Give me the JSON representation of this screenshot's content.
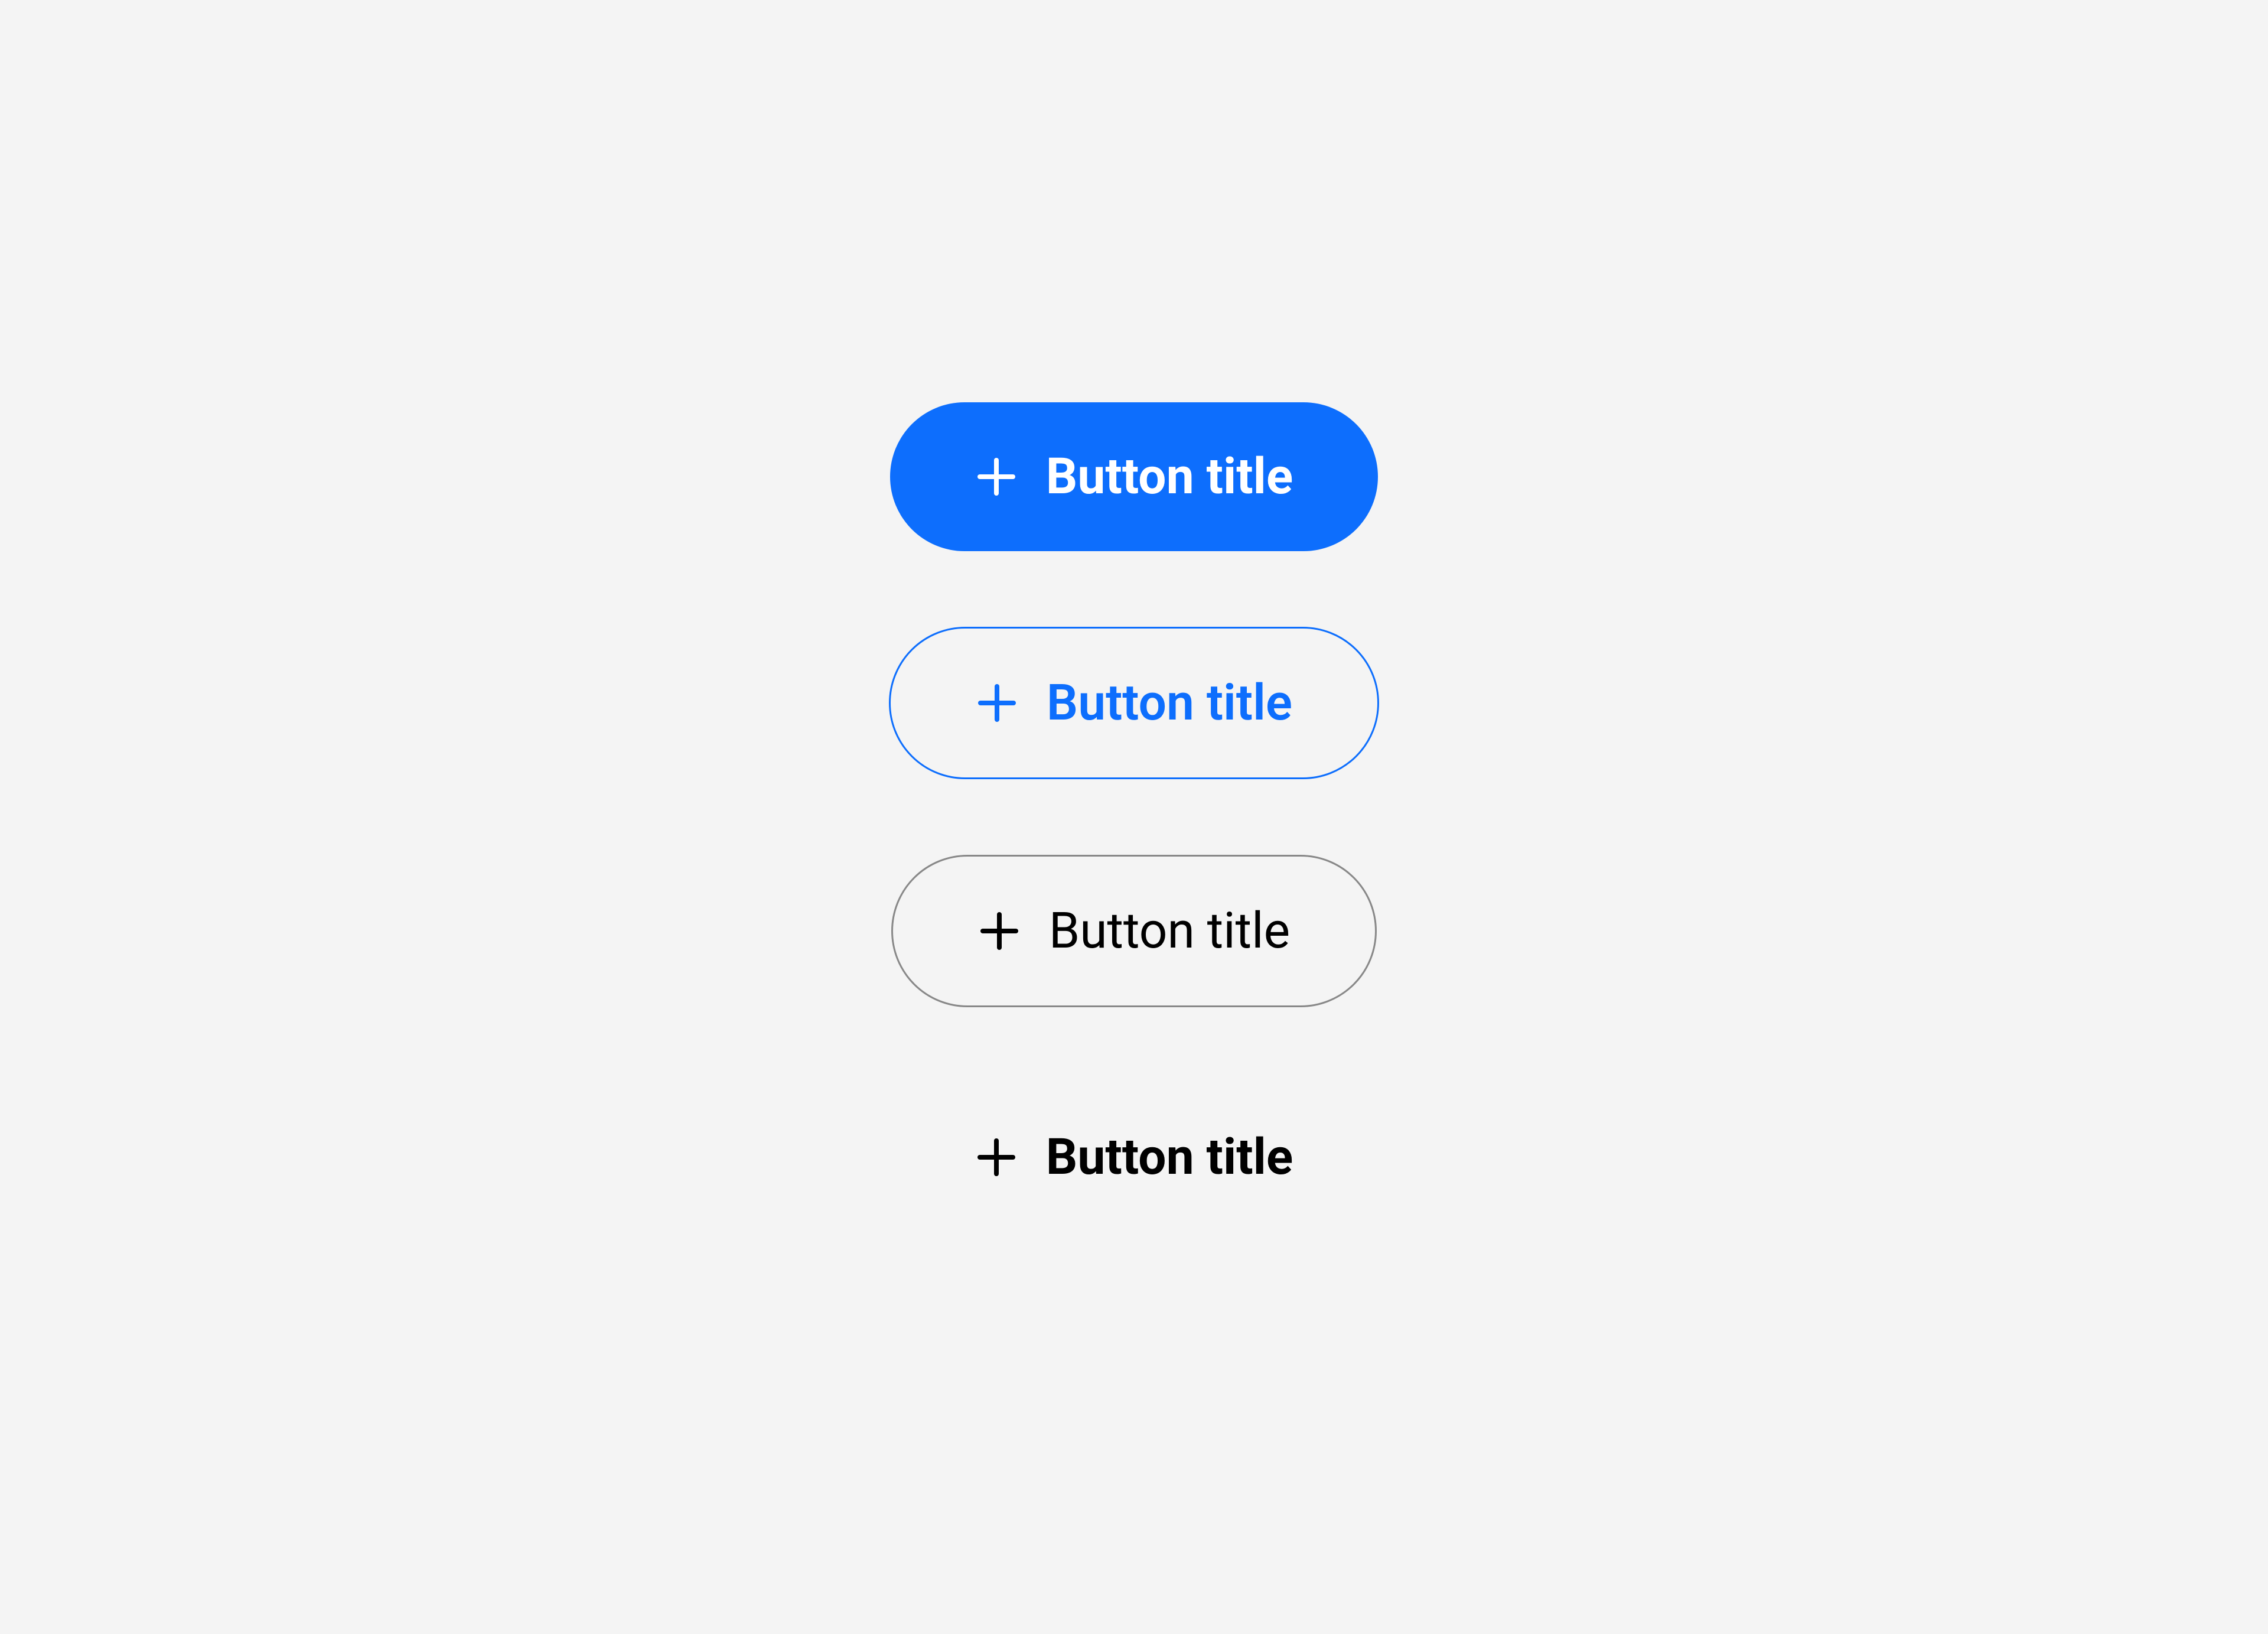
{
  "buttons": {
    "primary": {
      "label": "Button title"
    },
    "outline_blue": {
      "label": "Button title"
    },
    "outline_gray": {
      "label": "Button title"
    },
    "text": {
      "label": "Button title"
    }
  },
  "colors": {
    "primary": "#0d6efd",
    "background": "#f4f4f4",
    "border_gray": "#888888",
    "text_black": "#000000",
    "text_white": "#ffffff"
  }
}
